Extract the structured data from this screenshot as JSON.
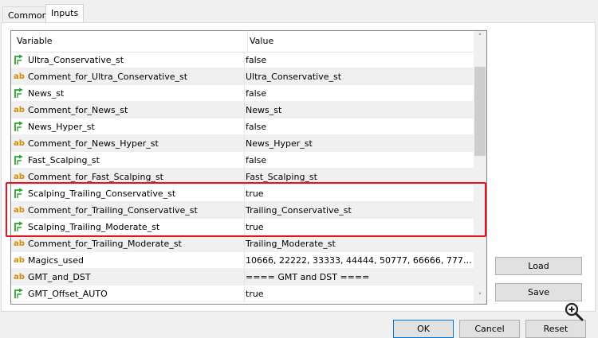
{
  "tabs": [
    {
      "label": "Common"
    },
    {
      "label": "Inputs"
    }
  ],
  "grid": {
    "columns": [
      "Variable",
      "Value"
    ],
    "rows": [
      {
        "type": "bool",
        "name": "Ultra_Conservative_st",
        "value": "false"
      },
      {
        "type": "string",
        "name": "Comment_for_Ultra_Conservative_st",
        "value": "Ultra_Conservative_st"
      },
      {
        "type": "bool",
        "name": "News_st",
        "value": "false"
      },
      {
        "type": "string",
        "name": "Comment_for_News_st",
        "value": "News_st"
      },
      {
        "type": "bool",
        "name": "News_Hyper_st",
        "value": "false"
      },
      {
        "type": "string",
        "name": "Comment_for_News_Hyper_st",
        "value": "News_Hyper_st"
      },
      {
        "type": "bool",
        "name": "Fast_Scalping_st",
        "value": "false"
      },
      {
        "type": "string",
        "name": "Comment_for_Fast_Scalping_st",
        "value": "Fast_Scalping_st"
      },
      {
        "type": "bool",
        "name": "Scalping_Trailing_Conservative_st",
        "value": "true"
      },
      {
        "type": "string",
        "name": "Comment_for_Trailing_Conservative_st",
        "value": "Trailing_Conservative_st"
      },
      {
        "type": "bool",
        "name": "Scalping_Trailing_Moderate_st",
        "value": "true"
      },
      {
        "type": "string",
        "name": "Comment_for_Trailing_Moderate_st",
        "value": "Trailing_Moderate_st"
      },
      {
        "type": "string",
        "name": "Magics_used",
        "value": "10666, 22222, 33333, 44444, 50777, 66666, 77777..."
      },
      {
        "type": "string",
        "name": "GMT_and_DST",
        "value": "==== GMT and DST ===="
      },
      {
        "type": "bool",
        "name": "GMT_Offset_AUTO",
        "value": "true"
      }
    ]
  },
  "icons": {
    "bool": "green-arrow-icon",
    "string": "ab-text-icon",
    "string_glyph": "ab"
  },
  "buttons": {
    "load": "Load",
    "save": "Save",
    "ok": "OK",
    "cancel": "Cancel",
    "reset": "Reset"
  },
  "colors": {
    "highlight": "#e8121f",
    "bool_icon": "#2aa52a",
    "string_icon": "#d88a00"
  }
}
